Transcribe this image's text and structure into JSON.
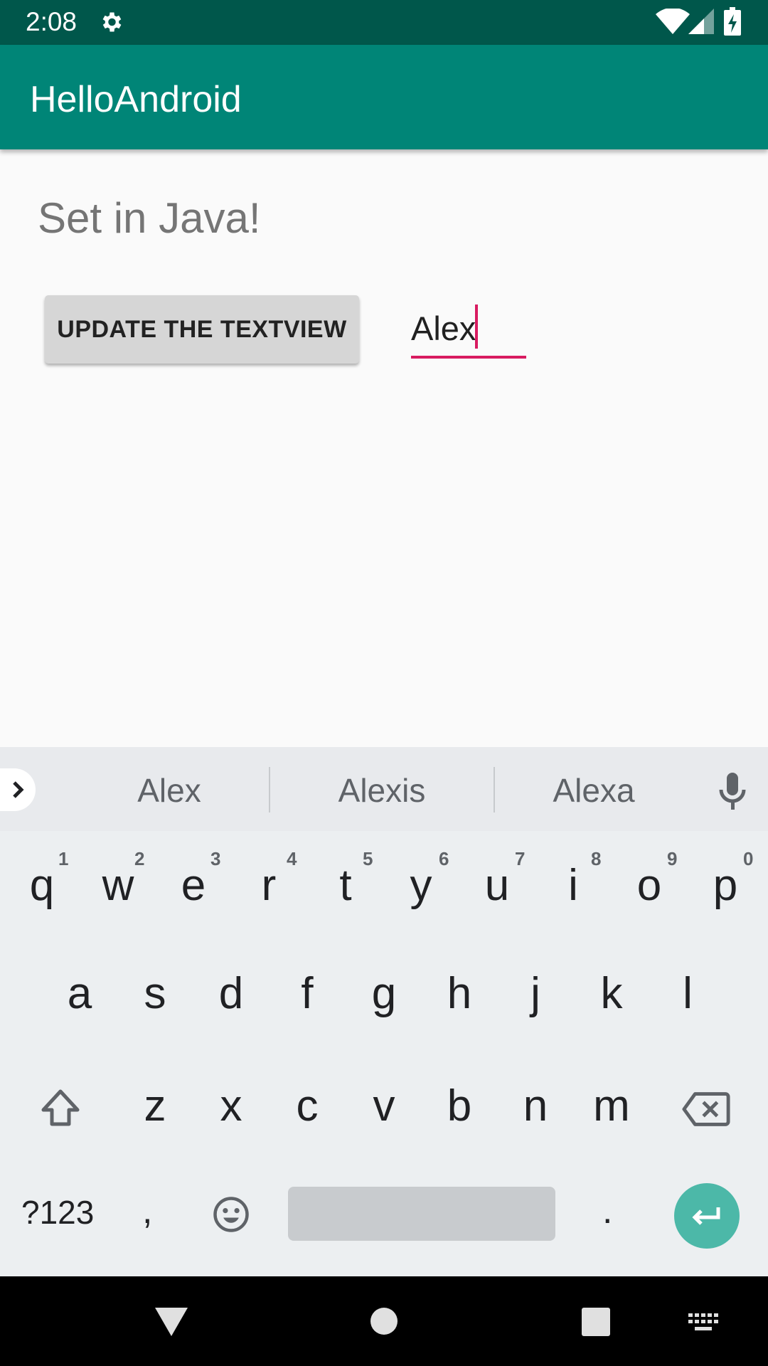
{
  "status_bar": {
    "time": "2:08",
    "icons": [
      "gear-icon",
      "wifi-icon",
      "signal-icon",
      "battery-charging-icon"
    ]
  },
  "app_bar": {
    "title": "HelloAndroid"
  },
  "content": {
    "textview": "Set in Java!",
    "update_button_label": "UPDATE THE TEXTVIEW",
    "name_input_value": "Alex"
  },
  "keyboard": {
    "suggestions": [
      "Alex",
      "Alexis",
      "Alexa"
    ],
    "row1": [
      "q",
      "w",
      "e",
      "r",
      "t",
      "y",
      "u",
      "i",
      "o",
      "p"
    ],
    "row1_hints": [
      "1",
      "2",
      "3",
      "4",
      "5",
      "6",
      "7",
      "8",
      "9",
      "0"
    ],
    "row2": [
      "a",
      "s",
      "d",
      "f",
      "g",
      "h",
      "j",
      "k",
      "l"
    ],
    "row3": [
      "z",
      "x",
      "c",
      "v",
      "b",
      "n",
      "m"
    ],
    "symbols_label": "?123",
    "comma": ",",
    "period": "."
  },
  "colors": {
    "status_bar": "#00574b",
    "app_bar": "#008577",
    "accent": "#d81b60",
    "enter_key": "#4cb8a8"
  }
}
